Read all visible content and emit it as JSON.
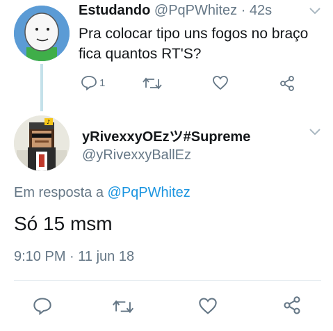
{
  "colors": {
    "text": "#14171a",
    "muted": "#657786",
    "link": "#1b95e0",
    "thread_line": "#c4e1ea",
    "divider": "#e6ecf0",
    "icon": "#657786"
  },
  "parent_tweet": {
    "display_name": "Estudando",
    "handle": "@PqPWhitez",
    "separator": "·",
    "time": "42s",
    "text_line1": "Pra colocar tipo uns fogos no braço",
    "text_line2": "fica quantos RT'S?",
    "reply_count": "1",
    "icons": [
      "reply-icon",
      "retweet-icon",
      "like-icon",
      "share-icon",
      "chevron-down-icon"
    ]
  },
  "main_tweet": {
    "display_name": "yRivexxyOEzツ#Supreme",
    "handle": "@yRivexxyBallEz",
    "reply_prefix": "Em resposta a",
    "reply_to": "@PqPWhitez",
    "text": "Só 15 msm",
    "timestamp": "9:10 PM · 11 jun 18",
    "icons": [
      "reply-icon",
      "retweet-icon",
      "like-icon",
      "share-icon",
      "chevron-down-icon"
    ]
  }
}
